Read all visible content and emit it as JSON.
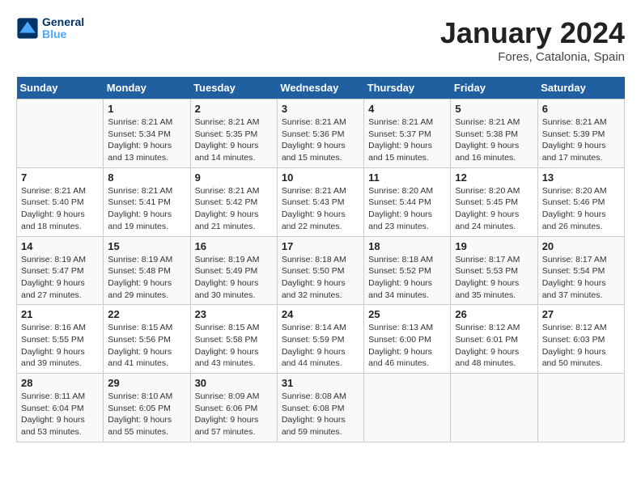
{
  "logo": {
    "text_general": "General",
    "text_blue": "Blue"
  },
  "title": "January 2024",
  "subtitle": "Fores, Catalonia, Spain",
  "days_of_week": [
    "Sunday",
    "Monday",
    "Tuesday",
    "Wednesday",
    "Thursday",
    "Friday",
    "Saturday"
  ],
  "weeks": [
    [
      {
        "day": "",
        "info": ""
      },
      {
        "day": "1",
        "info": "Sunrise: 8:21 AM\nSunset: 5:34 PM\nDaylight: 9 hours\nand 13 minutes."
      },
      {
        "day": "2",
        "info": "Sunrise: 8:21 AM\nSunset: 5:35 PM\nDaylight: 9 hours\nand 14 minutes."
      },
      {
        "day": "3",
        "info": "Sunrise: 8:21 AM\nSunset: 5:36 PM\nDaylight: 9 hours\nand 15 minutes."
      },
      {
        "day": "4",
        "info": "Sunrise: 8:21 AM\nSunset: 5:37 PM\nDaylight: 9 hours\nand 15 minutes."
      },
      {
        "day": "5",
        "info": "Sunrise: 8:21 AM\nSunset: 5:38 PM\nDaylight: 9 hours\nand 16 minutes."
      },
      {
        "day": "6",
        "info": "Sunrise: 8:21 AM\nSunset: 5:39 PM\nDaylight: 9 hours\nand 17 minutes."
      }
    ],
    [
      {
        "day": "7",
        "info": "Sunrise: 8:21 AM\nSunset: 5:40 PM\nDaylight: 9 hours\nand 18 minutes."
      },
      {
        "day": "8",
        "info": "Sunrise: 8:21 AM\nSunset: 5:41 PM\nDaylight: 9 hours\nand 19 minutes."
      },
      {
        "day": "9",
        "info": "Sunrise: 8:21 AM\nSunset: 5:42 PM\nDaylight: 9 hours\nand 21 minutes."
      },
      {
        "day": "10",
        "info": "Sunrise: 8:21 AM\nSunset: 5:43 PM\nDaylight: 9 hours\nand 22 minutes."
      },
      {
        "day": "11",
        "info": "Sunrise: 8:20 AM\nSunset: 5:44 PM\nDaylight: 9 hours\nand 23 minutes."
      },
      {
        "day": "12",
        "info": "Sunrise: 8:20 AM\nSunset: 5:45 PM\nDaylight: 9 hours\nand 24 minutes."
      },
      {
        "day": "13",
        "info": "Sunrise: 8:20 AM\nSunset: 5:46 PM\nDaylight: 9 hours\nand 26 minutes."
      }
    ],
    [
      {
        "day": "14",
        "info": "Sunrise: 8:19 AM\nSunset: 5:47 PM\nDaylight: 9 hours\nand 27 minutes."
      },
      {
        "day": "15",
        "info": "Sunrise: 8:19 AM\nSunset: 5:48 PM\nDaylight: 9 hours\nand 29 minutes."
      },
      {
        "day": "16",
        "info": "Sunrise: 8:19 AM\nSunset: 5:49 PM\nDaylight: 9 hours\nand 30 minutes."
      },
      {
        "day": "17",
        "info": "Sunrise: 8:18 AM\nSunset: 5:50 PM\nDaylight: 9 hours\nand 32 minutes."
      },
      {
        "day": "18",
        "info": "Sunrise: 8:18 AM\nSunset: 5:52 PM\nDaylight: 9 hours\nand 34 minutes."
      },
      {
        "day": "19",
        "info": "Sunrise: 8:17 AM\nSunset: 5:53 PM\nDaylight: 9 hours\nand 35 minutes."
      },
      {
        "day": "20",
        "info": "Sunrise: 8:17 AM\nSunset: 5:54 PM\nDaylight: 9 hours\nand 37 minutes."
      }
    ],
    [
      {
        "day": "21",
        "info": "Sunrise: 8:16 AM\nSunset: 5:55 PM\nDaylight: 9 hours\nand 39 minutes."
      },
      {
        "day": "22",
        "info": "Sunrise: 8:15 AM\nSunset: 5:56 PM\nDaylight: 9 hours\nand 41 minutes."
      },
      {
        "day": "23",
        "info": "Sunrise: 8:15 AM\nSunset: 5:58 PM\nDaylight: 9 hours\nand 43 minutes."
      },
      {
        "day": "24",
        "info": "Sunrise: 8:14 AM\nSunset: 5:59 PM\nDaylight: 9 hours\nand 44 minutes."
      },
      {
        "day": "25",
        "info": "Sunrise: 8:13 AM\nSunset: 6:00 PM\nDaylight: 9 hours\nand 46 minutes."
      },
      {
        "day": "26",
        "info": "Sunrise: 8:12 AM\nSunset: 6:01 PM\nDaylight: 9 hours\nand 48 minutes."
      },
      {
        "day": "27",
        "info": "Sunrise: 8:12 AM\nSunset: 6:03 PM\nDaylight: 9 hours\nand 50 minutes."
      }
    ],
    [
      {
        "day": "28",
        "info": "Sunrise: 8:11 AM\nSunset: 6:04 PM\nDaylight: 9 hours\nand 53 minutes."
      },
      {
        "day": "29",
        "info": "Sunrise: 8:10 AM\nSunset: 6:05 PM\nDaylight: 9 hours\nand 55 minutes."
      },
      {
        "day": "30",
        "info": "Sunrise: 8:09 AM\nSunset: 6:06 PM\nDaylight: 9 hours\nand 57 minutes."
      },
      {
        "day": "31",
        "info": "Sunrise: 8:08 AM\nSunset: 6:08 PM\nDaylight: 9 hours\nand 59 minutes."
      },
      {
        "day": "",
        "info": ""
      },
      {
        "day": "",
        "info": ""
      },
      {
        "day": "",
        "info": ""
      }
    ]
  ]
}
